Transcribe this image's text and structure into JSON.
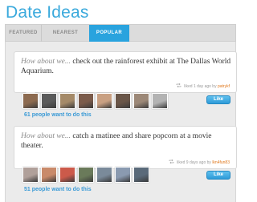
{
  "page": {
    "title": "Date Ideas"
  },
  "tabs": [
    {
      "label": "FEATURED",
      "active": false
    },
    {
      "label": "NEAREST",
      "active": false
    },
    {
      "label": "POPULAR",
      "active": true
    }
  ],
  "ideas": [
    {
      "lead": "How about we...",
      "text": "check out the rainforest exhibit at The Dallas World Aquarium.",
      "meta_prefix": "liked 1 day ago by",
      "meta_user": "patrykf",
      "like_label": "Like",
      "want_text": "61 people want to do this",
      "avatar_colors": [
        "#8c6a4f",
        "#5a5a5a",
        "#a58a68",
        "#7b5b4a",
        "#c9a082",
        "#6a5648",
        "#9c8877",
        "#b3b3b3"
      ]
    },
    {
      "lead": "How about we...",
      "text": "catch a matinee and share popcorn at a movie theater.",
      "meta_prefix": "liked 9 days ago by",
      "meta_user": "lkn4fun83",
      "like_label": "Like",
      "want_text": "51 people want to do this",
      "avatar_colors": [
        "#b0a09a",
        "#c98a6a",
        "#cc5a4a",
        "#6a7a5a",
        "#7a8a9a",
        "#8a9ab0",
        "#5a6a7a"
      ]
    }
  ],
  "colors": {
    "accent": "#29a3de",
    "title": "#3aa9dc",
    "username": "#e0781c"
  }
}
